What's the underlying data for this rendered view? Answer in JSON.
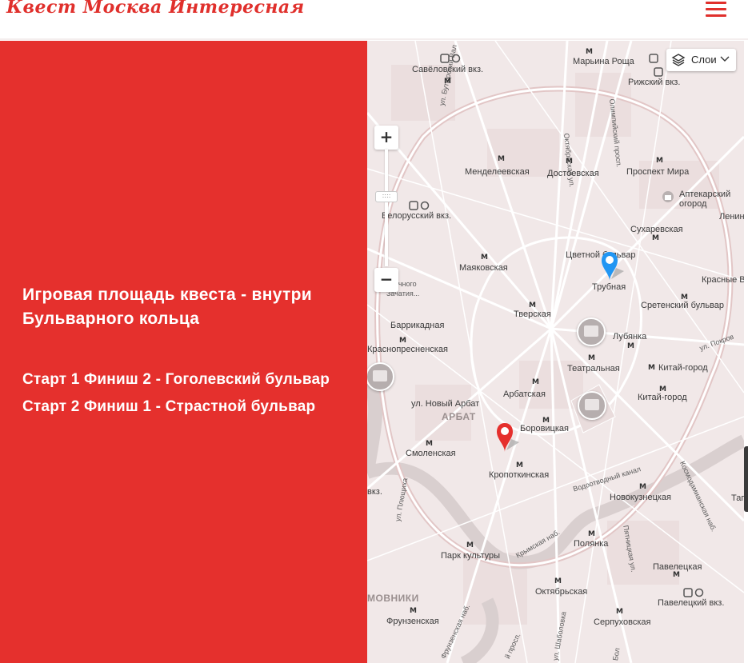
{
  "header": {
    "logo_text": "Квест Москва Интересная",
    "menu_icon": "hamburger-menu-icon"
  },
  "panel": {
    "title": "Игровая площадь квеста - внутри Бульварного кольца",
    "start_line_1": "Старт 1 Финиш 2 - Гоголевский бульвар",
    "start_line_2": "Старт 2 Финиш 1 - Страстной бульвар",
    "background_color": "#e5302d"
  },
  "map": {
    "layers_label": "Слои",
    "zoom_in": "+",
    "zoom_out": "−",
    "zoom_handle": "::::",
    "labels": {
      "savelovsky": "Савёловский вкз.",
      "maryina_roshcha": "Марьина Роща",
      "rizhsky": "Рижский вкз.",
      "butyrsky_val": "ул. Бутырский Вал",
      "oktyabrskaya_ul": "Октябрьская ул.",
      "olimpiysky": "Олимпийский просп.",
      "mendeleevskaya": "Менделеевская",
      "dostoevskaya": "Достоевская",
      "prospekt_mira": "Проспект Мира",
      "aptekarsky": "Аптекарский огород",
      "lenin": "Ленин",
      "belorussky": "Белорусский вкз.",
      "sukharevskaya": "Сухаревская",
      "tsvetnoy": "Цветной бульвар",
      "mayakovskaya": "Маяковская",
      "trubnaya": "Трубная",
      "krasnye_vorota": "Красные В",
      "sretensky": "Сретенский бульвар",
      "tverskaya": "Тверская",
      "barrikadnaya": "Баррикадная",
      "krasnopresnenskaya": "Краснопресненская",
      "lubyanka": "Лубянка",
      "pokrovka": "ул. Покров",
      "teatralnaya": "Театральная",
      "kitay_gorod": "Китай-город",
      "kitay_gorod_2": "Китай-город",
      "arbatskaya": "Арбатская",
      "novy_arbat": "ул. Новый Арбат",
      "arbat": "АРБАТ",
      "borovitskaya": "Боровицкая",
      "smolenskaya": "Смоленская",
      "kropotkinskaya": "Кропоткинская",
      "vodootvodny": "Водоотводный канал",
      "kosmodamianskaya": "Космодамианская наб.",
      "vkz": "вкз.",
      "plyushchikha": "ул. Плющиха",
      "novokuznetskaya": "Новокузнецкая",
      "krymskaya": "Крымская наб.",
      "polyanka": "Полянка",
      "pyatnitskaya": "Пятницкая ул.",
      "park_kultury": "Парк культуры",
      "paveletskaya": "Павелецкая",
      "oktyabrskaya": "Октябрьская",
      "paveletsky_vkz": "Павелецкий вкз.",
      "khamovniki": "МОВНИКИ",
      "frunzenskaya": "Фрунзенская",
      "serpukhovskaya": "Серпуховская",
      "frunzenskaya_nab": "Фрунзенская наб.",
      "leninsky": "й просп.",
      "shabolovka": "ул. Шаболовка",
      "bolshaya_ord": "Бол",
      "tag": "Таг",
      "zachatiya": "ор\nорочного\nЗачатия..."
    },
    "pins": {
      "blue": "blue-map-pin-icon",
      "red": "red-map-pin-icon"
    },
    "colors": {
      "map_bg": "#f1e8e8",
      "road": "#ffffff",
      "major_road": "#e4cccc",
      "blue_pin": "#2196f3",
      "red_pin": "#e5302d"
    }
  }
}
